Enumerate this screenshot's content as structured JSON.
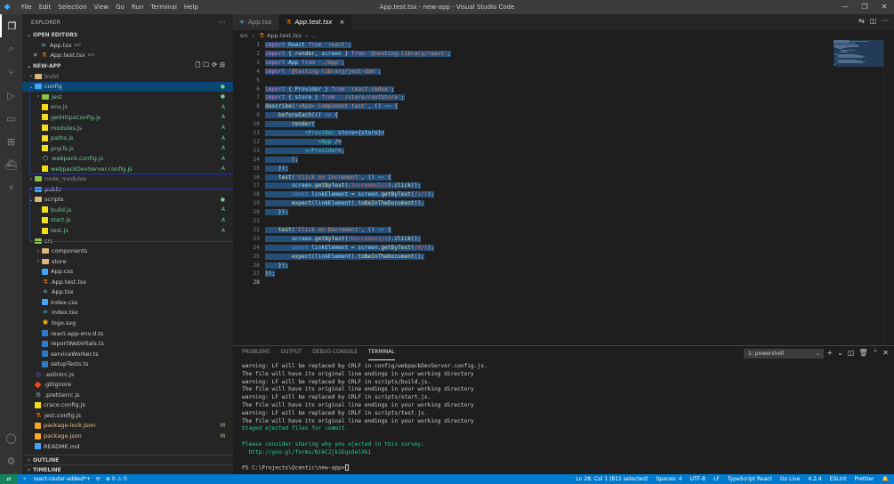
{
  "window": {
    "title": "App.test.tsx - new-app - Visual Studio Code",
    "menu": [
      "File",
      "Edit",
      "Selection",
      "View",
      "Go",
      "Run",
      "Terminal",
      "Help"
    ]
  },
  "explorer": {
    "header": "EXPLORER",
    "open_editors_title": "OPEN EDITORS",
    "open_editors": [
      {
        "name": "App.tsx",
        "desc": "src"
      },
      {
        "name": "App.test.tsx",
        "desc": "src"
      }
    ],
    "project_title": "NEW-APP",
    "tree": [
      {
        "label": "build",
        "type": "folder",
        "level": 0,
        "open": false,
        "color": "yellow"
      },
      {
        "label": "config",
        "type": "folder",
        "level": 0,
        "open": true,
        "color": "blue",
        "badge": "●",
        "selected": true
      },
      {
        "label": "jest",
        "type": "folder",
        "level": 1,
        "open": false,
        "color": "green",
        "badge": "●"
      },
      {
        "label": "env.js",
        "type": "js",
        "level": 1,
        "badge": "A"
      },
      {
        "label": "getHttpsConfig.js",
        "type": "js",
        "level": 1,
        "badge": "A"
      },
      {
        "label": "modules.js",
        "type": "js",
        "level": 1,
        "badge": "A"
      },
      {
        "label": "paths.js",
        "type": "js",
        "level": 1,
        "badge": "A"
      },
      {
        "label": "pnpTs.js",
        "type": "js",
        "level": 1,
        "badge": "A"
      },
      {
        "label": "webpack.config.js",
        "type": "webpack",
        "level": 1,
        "badge": "A"
      },
      {
        "label": "webpackDevServer.config.js",
        "type": "js",
        "level": 1,
        "badge": "A"
      },
      {
        "label": "node_modules",
        "type": "folder",
        "level": 0,
        "open": false,
        "color": "green"
      },
      {
        "label": "public",
        "type": "folder",
        "level": 0,
        "open": false,
        "color": "blue"
      },
      {
        "label": "scripts",
        "type": "folder",
        "level": 0,
        "open": true,
        "color": "yellow",
        "badge": "●"
      },
      {
        "label": "build.js",
        "type": "js",
        "level": 1,
        "badge": "A"
      },
      {
        "label": "start.js",
        "type": "js",
        "level": 1,
        "badge": "A"
      },
      {
        "label": "test.js",
        "type": "js",
        "level": 1,
        "badge": "A"
      },
      {
        "label": "src",
        "type": "folder",
        "level": 0,
        "open": true,
        "color": "green"
      },
      {
        "label": "components",
        "type": "folder",
        "level": 1,
        "open": false,
        "color": "yellow"
      },
      {
        "label": "store",
        "type": "folder",
        "level": 1,
        "open": false,
        "color": "yellow"
      },
      {
        "label": "App.css",
        "type": "css",
        "level": 1
      },
      {
        "label": "App.test.tsx",
        "type": "test",
        "level": 1
      },
      {
        "label": "App.tsx",
        "type": "react",
        "level": 1
      },
      {
        "label": "index.css",
        "type": "css",
        "level": 1
      },
      {
        "label": "index.tsx",
        "type": "react",
        "level": 1
      },
      {
        "label": "logo.svg",
        "type": "svg",
        "level": 1
      },
      {
        "label": "react-app-env.d.ts",
        "type": "ts",
        "level": 1
      },
      {
        "label": "reportWebVitals.ts",
        "type": "ts",
        "level": 1
      },
      {
        "label": "serviceWorker.ts",
        "type": "ts",
        "level": 1
      },
      {
        "label": "setupTests.ts",
        "type": "ts",
        "level": 1
      },
      {
        "label": ".eslintrc.js",
        "type": "eslint",
        "level": 0
      },
      {
        "label": ".gitignore",
        "type": "git",
        "level": 0
      },
      {
        "label": ".prettierrc.js",
        "type": "gear",
        "level": 0
      },
      {
        "label": "craco.config.js",
        "type": "js",
        "level": 0
      },
      {
        "label": "jest.config.js",
        "type": "test",
        "level": 0
      },
      {
        "label": "package-lock.json",
        "type": "json",
        "level": 0,
        "badge": "M"
      },
      {
        "label": "package.json",
        "type": "json",
        "level": 0,
        "badge": "M"
      },
      {
        "label": "README.md",
        "type": "md",
        "level": 0
      }
    ],
    "outline_title": "OUTLINE",
    "timeline_title": "TIMELINE"
  },
  "tabs": [
    {
      "label": "App.tsx",
      "active": false
    },
    {
      "label": "App.test.tsx",
      "active": true,
      "close": "×"
    }
  ],
  "breadcrumb": [
    "src",
    "›",
    "App.test.tsx",
    "›",
    "..."
  ],
  "editor": {
    "lines": [
      "import React from 'react';",
      "import { render, screen } from '@testing-library/react';",
      "import App from './App';",
      "import '@testing-library/jest-dom';",
      "",
      "import { Provider } from 'react-redux';",
      "import { store } from './store/rootStore';",
      "describe('<App> Component test', () => {",
      "    beforeEach(() => {",
      "        render(",
      "            <Provider store={store}>",
      "                <App />",
      "            </Provider>,",
      "        );",
      "    });",
      "    test('Click on Increment', () => {",
      "        screen.getByText(/Increment/i).click();",
      "        const linkElement = screen.getByText(/1/i);",
      "        expect(linkElement).toBeInTheDocument();",
      "    });",
      "",
      "    test('Click on Decrement', () => {",
      "        screen.getByText(/Decrement/i).click();",
      "        const linkElement = screen.getByText(/0/i);",
      "        expect(linkElement).toBeInTheDocument();",
      "    });",
      "});",
      ""
    ]
  },
  "panel": {
    "tabs": [
      "PROBLEMS",
      "OUTPUT",
      "DEBUG CONSOLE",
      "TERMINAL"
    ],
    "active_tab": "TERMINAL",
    "terminal_select": "1: powershell",
    "terminal_lines": [
      {
        "text": "warning: LF will be replaced by CRLF in config/webpackDevServer.config.js.",
        "color": "normal"
      },
      {
        "text": "The file will have its original line endings in your working directory",
        "color": "normal"
      },
      {
        "text": "warning: LF will be replaced by CRLF in scripts/build.js.",
        "color": "normal"
      },
      {
        "text": "The file will have its original line endings in your working directory",
        "color": "normal"
      },
      {
        "text": "warning: LF will be replaced by CRLF in scripts/start.js.",
        "color": "normal"
      },
      {
        "text": "The file will have its original line endings in your working directory",
        "color": "normal"
      },
      {
        "text": "warning: LF will be replaced by CRLF in scripts/test.js.",
        "color": "normal"
      },
      {
        "text": "The file will have its original line endings in your working directory",
        "color": "normal"
      },
      {
        "text": "Staged ejected files for commit.",
        "color": "green"
      },
      {
        "text": "",
        "color": "normal"
      },
      {
        "text": "Please consider sharing why you ejected in this survey:",
        "color": "green"
      },
      {
        "text": "  http://goo.gl/forms/Bi6CZjk1EqsdelXk1",
        "color": "green"
      },
      {
        "text": "",
        "color": "normal"
      },
      {
        "text": "PS C:\\Projects\\Qcentic\\new-app>",
        "color": "normal",
        "cursor": true
      }
    ]
  },
  "statusbar": {
    "branch": "react-router-added*+",
    "sync": "⟳",
    "problems": "⊗ 0 ⚠ 0",
    "items_right": [
      "Ln 28, Col 1 (811 selected)",
      "Spaces: 4",
      "UTF-8",
      "LF",
      "TypeScript React",
      "Go Live",
      "4.2.4",
      "ESLint",
      "Prettier"
    ]
  },
  "colors": {
    "accent": "#007acc",
    "selection": "#264f78",
    "annotation_box": "#1c2fd8"
  }
}
